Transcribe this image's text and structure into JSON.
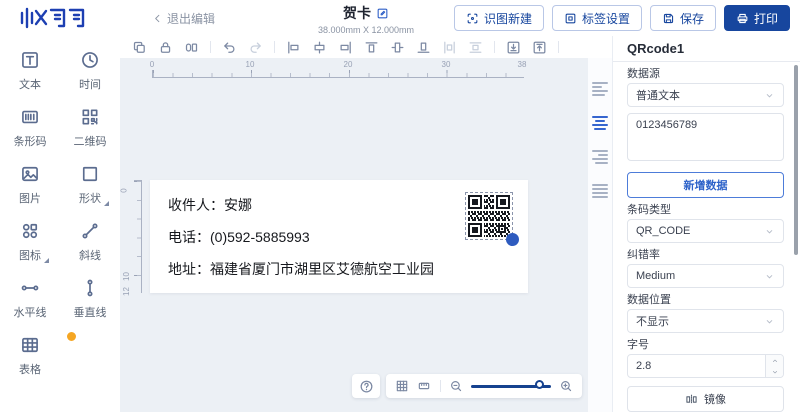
{
  "header": {
    "back": "退出编辑",
    "title": "贺卡",
    "size": "38.000mm X 12.000mm",
    "buttons": {
      "scan": "识图新建",
      "settings": "标签设置",
      "save": "保存",
      "print": "打印"
    }
  },
  "sidebar": {
    "items": [
      {
        "label": "文本"
      },
      {
        "label": "时间"
      },
      {
        "label": "条形码"
      },
      {
        "label": "二维码"
      },
      {
        "label": "图片"
      },
      {
        "label": "形状"
      },
      {
        "label": "图标"
      },
      {
        "label": "斜线"
      },
      {
        "label": "水平线"
      },
      {
        "label": "垂直线"
      },
      {
        "label": "表格"
      }
    ]
  },
  "canvas": {
    "hruler": [
      "0",
      "10",
      "20",
      "30",
      "38"
    ],
    "vruler": [
      "0",
      "10",
      "12"
    ],
    "card": {
      "line1": "收件人：安娜",
      "line2": "电话：(0)592-5885993",
      "line3": "地址：福建省厦门市湖里区艾德航空工业园"
    }
  },
  "panel": {
    "title": "QRcode1",
    "source_label": "数据源",
    "source_value": "普通文本",
    "data_value": "0123456789",
    "add_data_label": "新增数据",
    "type_label": "条码类型",
    "type_value": "QR_CODE",
    "ecc_label": "纠错率",
    "ecc_value": "Medium",
    "position_label": "数据位置",
    "position_value": "不显示",
    "fontsize_label": "字号",
    "fontsize_value": "2.8",
    "mirror_label": "镜像"
  },
  "colors": {
    "primary": "#17469e",
    "accent_blue": "#2e5bbf",
    "canvas_bg": "#ecf0f5",
    "badge_orange": "#f5a623"
  }
}
